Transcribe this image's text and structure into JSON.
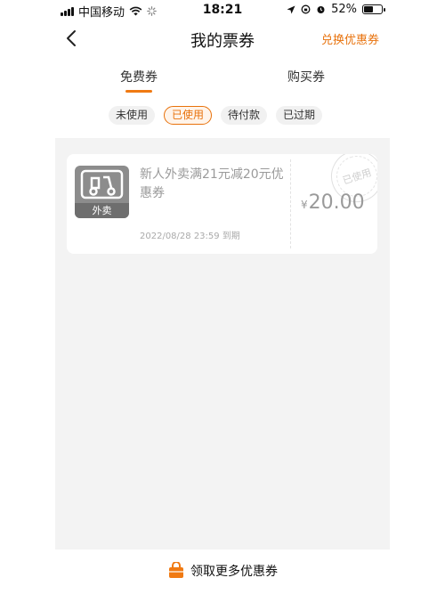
{
  "status_bar": {
    "carrier": "中国移动",
    "time": "18:21",
    "battery_percent": "52%",
    "battery_level": 0.52
  },
  "nav": {
    "title": "我的票券",
    "action_label": "兑换优惠券"
  },
  "tabs": [
    {
      "label": "免费券",
      "active": true
    },
    {
      "label": "购买券",
      "active": false
    }
  ],
  "filters": [
    {
      "label": "未使用",
      "active": false
    },
    {
      "label": "已使用",
      "active": true
    },
    {
      "label": "待付款",
      "active": false
    },
    {
      "label": "已过期",
      "active": false
    }
  ],
  "coupons": [
    {
      "thumb_label": "外卖",
      "title": "新人外卖满21元减20元优惠券",
      "expiry": "2022/08/28 23:59 到期",
      "currency": "¥",
      "amount": "20.00",
      "stamp": "已使用"
    }
  ],
  "bottom_link": {
    "label": "领取更多优惠券"
  },
  "colors": {
    "accent": "#e8720c",
    "list_bg": "#f3f3f3"
  }
}
